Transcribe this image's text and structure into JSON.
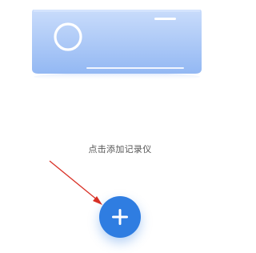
{
  "prompt": {
    "text": "点击添加记录仪"
  },
  "add_button": {
    "icon": "plus-icon",
    "color": "#2f7de1"
  },
  "illustration": {
    "icon": "recorder-device-icon",
    "color": "#a9c8f5"
  },
  "annotation": {
    "icon": "arrow-pointer-icon",
    "color": "#d93025"
  }
}
